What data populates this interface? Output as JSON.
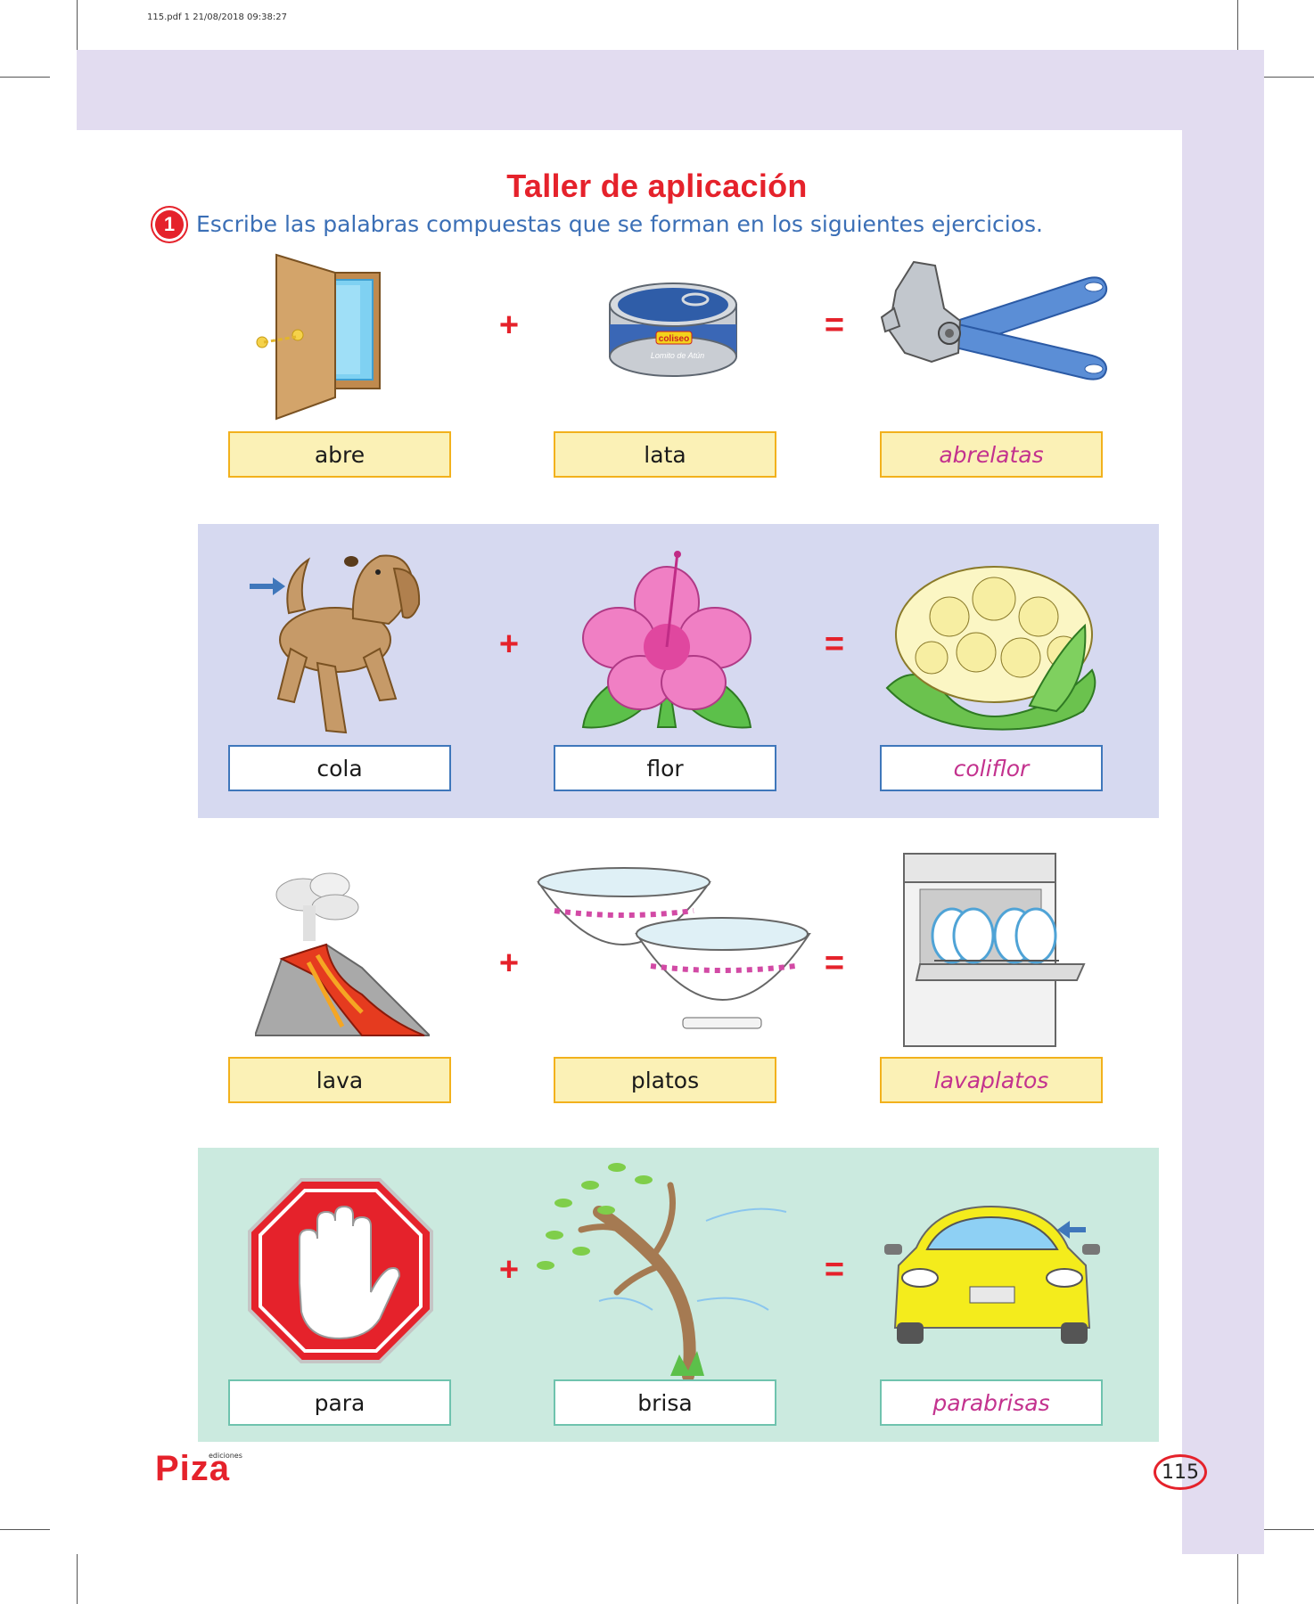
{
  "header": {
    "meta": "115.pdf   1   21/08/2018   09:38:27"
  },
  "title": "Taller de aplicación",
  "exercise": {
    "number": "1",
    "instruction": "Escribe las palabras compuestas que se forman en los siguientes ejercicios."
  },
  "operators": {
    "plus": "+",
    "equals": "="
  },
  "rows": [
    {
      "word1": "abre",
      "word2": "lata",
      "answer": "abrelatas",
      "icons": [
        "door-icon",
        "tuna-can-icon",
        "can-opener-icon"
      ],
      "can_brand": "coliseo",
      "can_caption": "Lomito de Atún"
    },
    {
      "word1": "cola",
      "word2": "flor",
      "answer": "coliflor",
      "icons": [
        "dog-tail-icon",
        "hibiscus-flower-icon",
        "cauliflower-icon"
      ]
    },
    {
      "word1": "lava",
      "word2": "platos",
      "answer": "lavaplatos",
      "icons": [
        "volcano-icon",
        "bowls-icon",
        "dishwasher-icon"
      ]
    },
    {
      "word1": "para",
      "word2": "brisa",
      "answer": "parabrisas",
      "icons": [
        "stop-hand-icon",
        "windy-tree-icon",
        "car-windshield-icon"
      ]
    }
  ],
  "footer": {
    "logo": "Piza",
    "logo_sub": "ediciones",
    "page": "115"
  },
  "colors": {
    "accent": "#e5222b",
    "instruction": "#3b6fb6",
    "answer": "#c3328e",
    "band": "#e2dcf0"
  }
}
